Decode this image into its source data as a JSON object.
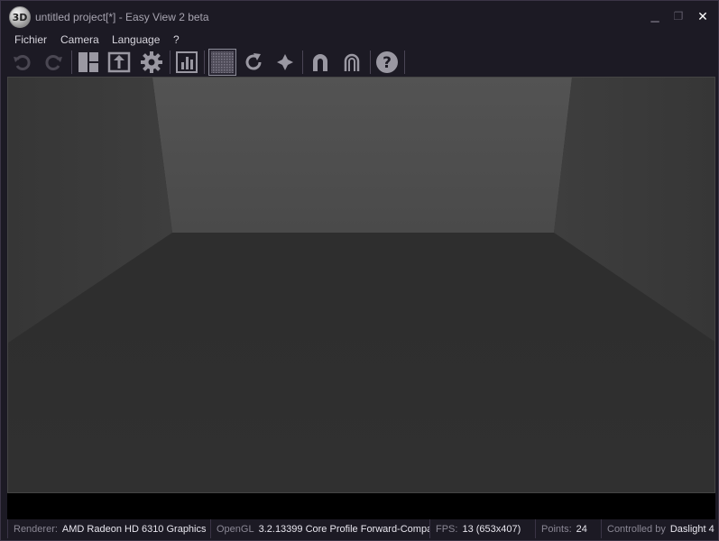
{
  "window": {
    "logo_text": "3D",
    "title": "untitled project[*] - Easy View 2 beta",
    "minimize_glyph": "▁",
    "maximize_glyph": "❐",
    "close_glyph": "✕"
  },
  "menu": {
    "items": [
      "Fichier",
      "Camera",
      "Language",
      "?"
    ]
  },
  "toolbar": {
    "icons": [
      {
        "name": "undo-icon",
        "enabled": false
      },
      {
        "name": "redo-icon",
        "enabled": false
      },
      {
        "name": "layout-icon",
        "enabled": true
      },
      {
        "name": "export-icon",
        "enabled": true
      },
      {
        "name": "gear-icon",
        "enabled": true
      },
      {
        "name": "chart-icon",
        "enabled": true
      },
      {
        "name": "texture-icon",
        "enabled": true,
        "active": true
      },
      {
        "name": "refresh-icon",
        "enabled": true
      },
      {
        "name": "light-icon",
        "enabled": true
      },
      {
        "name": "magnet-icon",
        "enabled": true
      },
      {
        "name": "magnet-outline-icon",
        "enabled": true
      },
      {
        "name": "help-icon",
        "enabled": true
      }
    ]
  },
  "statusbar": {
    "renderer_label": "Renderer:",
    "renderer_value": "AMD Radeon HD 6310 Graphics",
    "opengl_label": "OpenGL",
    "opengl_value": "3.2.13399 Core Profile Forward-Compa",
    "fps_label": "FPS:",
    "fps_value": "13 (653x407)",
    "points_label": "Points:",
    "points_value": "24",
    "controlled_label": "Controlled by",
    "controlled_value": "Daslight 4"
  },
  "colors": {
    "window_bg": "#1c1a24",
    "back_wall": "#4c4c4c",
    "floor": "#2f2f2f",
    "side_wall": "#383838"
  }
}
